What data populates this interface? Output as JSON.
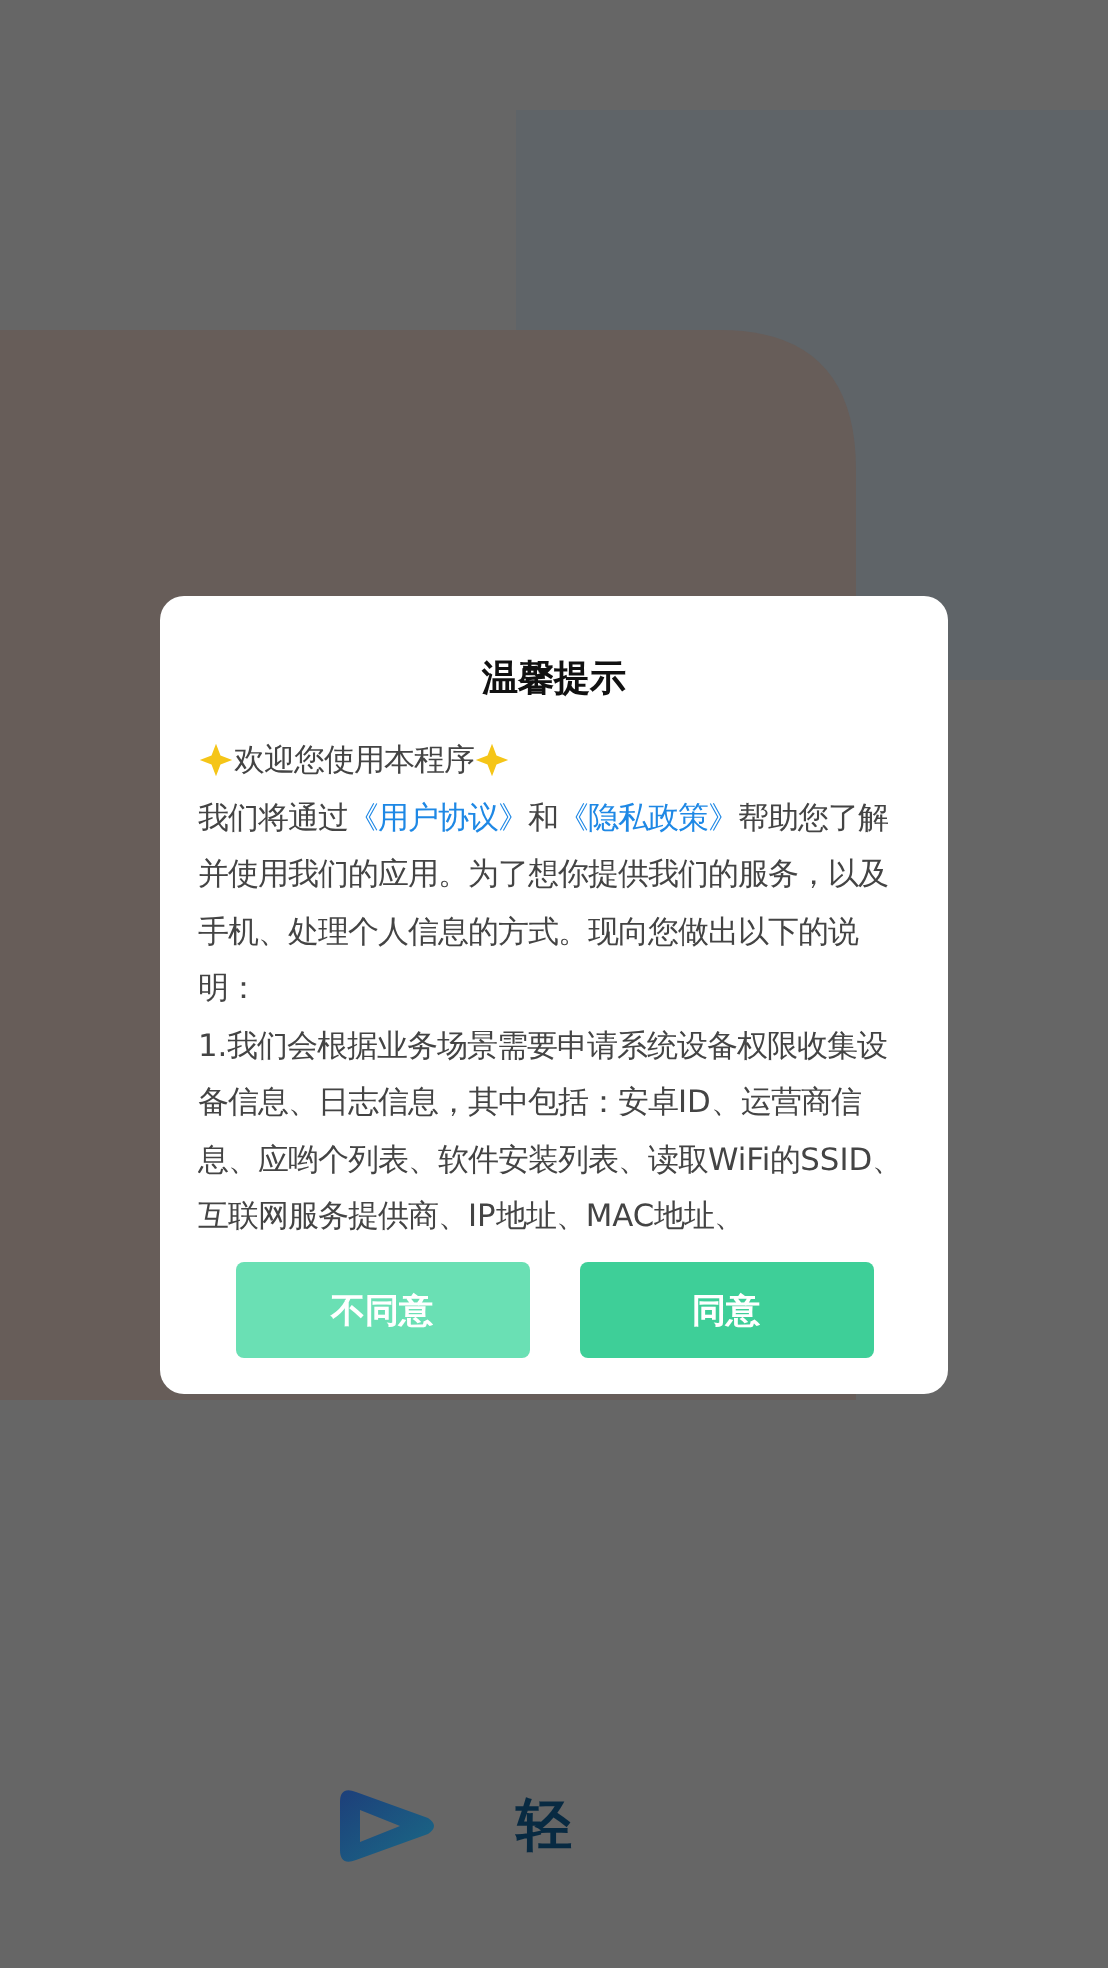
{
  "dialog": {
    "title": "温馨提示",
    "welcome": "欢迎您使用本程序",
    "intro": [
      {
        "kind": "text",
        "text": "我们将通过"
      },
      {
        "kind": "link",
        "text": "《用户协议》"
      },
      {
        "kind": "text",
        "text": "和"
      },
      {
        "kind": "link",
        "text": "《隐私政策》"
      },
      {
        "kind": "text",
        "text": "帮助您了解并使用我们的应用。为了想你提供我们的服务，以及手机、处理个人信息的方式。现向您做出以下的说明："
      }
    ],
    "paragraphs": [
      "1.我们会根据业务场景需要申请系统设备权限收集设备信息、日志信息，其中包括：安卓ID、运营商信息、应哟个列表、软件安装列表、读取WiFi的SSID、互联网服务提供商、IP地址、MAC地址、"
    ],
    "buttons": [
      {
        "label": "不同意",
        "kind": "secondary"
      },
      {
        "label": "同意",
        "kind": "primary"
      }
    ]
  },
  "brand": {
    "name": "轻"
  }
}
